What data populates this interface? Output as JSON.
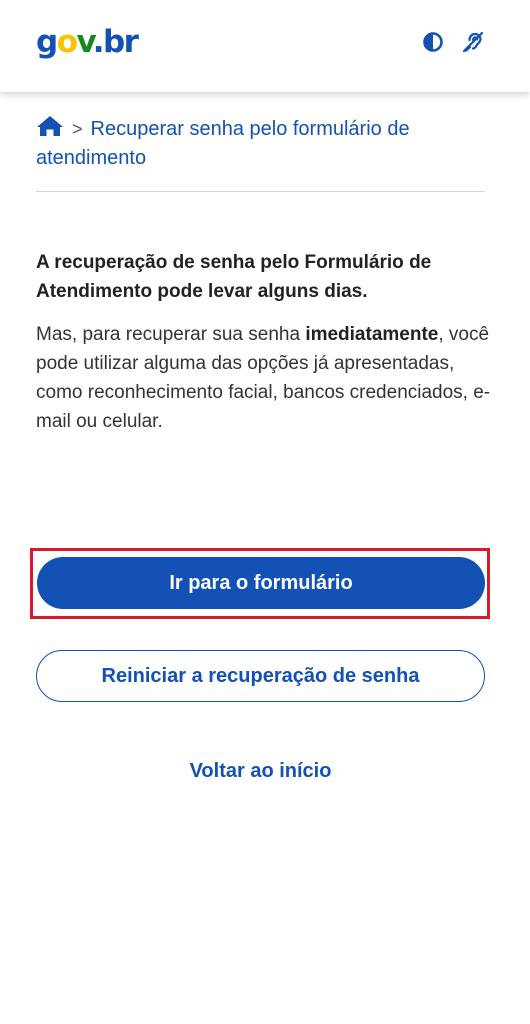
{
  "header": {
    "logo": {
      "part1": "g",
      "part2": "o",
      "part3": "v",
      "dot": ".",
      "part4": "br"
    },
    "icons": [
      "contrast-icon",
      "hearing-icon"
    ]
  },
  "breadcrumb": {
    "home_icon": "home-icon",
    "separator": ">",
    "current": "Recuperar senha pelo formulário de atendimento"
  },
  "content": {
    "lead": "A recuperação de senha pelo Formulário de Atendimento pode levar alguns dias.",
    "body_prefix": "Mas, para recuperar sua senha ",
    "body_strong": "imediatamente",
    "body_suffix": ", você pode utilizar alguma das opções já apresentadas, como reconhecimento facial, bancos credenciados, e-mail ou celular."
  },
  "actions": {
    "primary_label": "Ir para o formulário",
    "secondary_label": "Reiniciar a recuperação de senha",
    "link_label": "Voltar ao início"
  },
  "colors": {
    "brand_blue": "#1351b4",
    "logo_yellow": "#f8c300",
    "logo_green": "#168821",
    "highlight_red": "#d81b2a"
  }
}
